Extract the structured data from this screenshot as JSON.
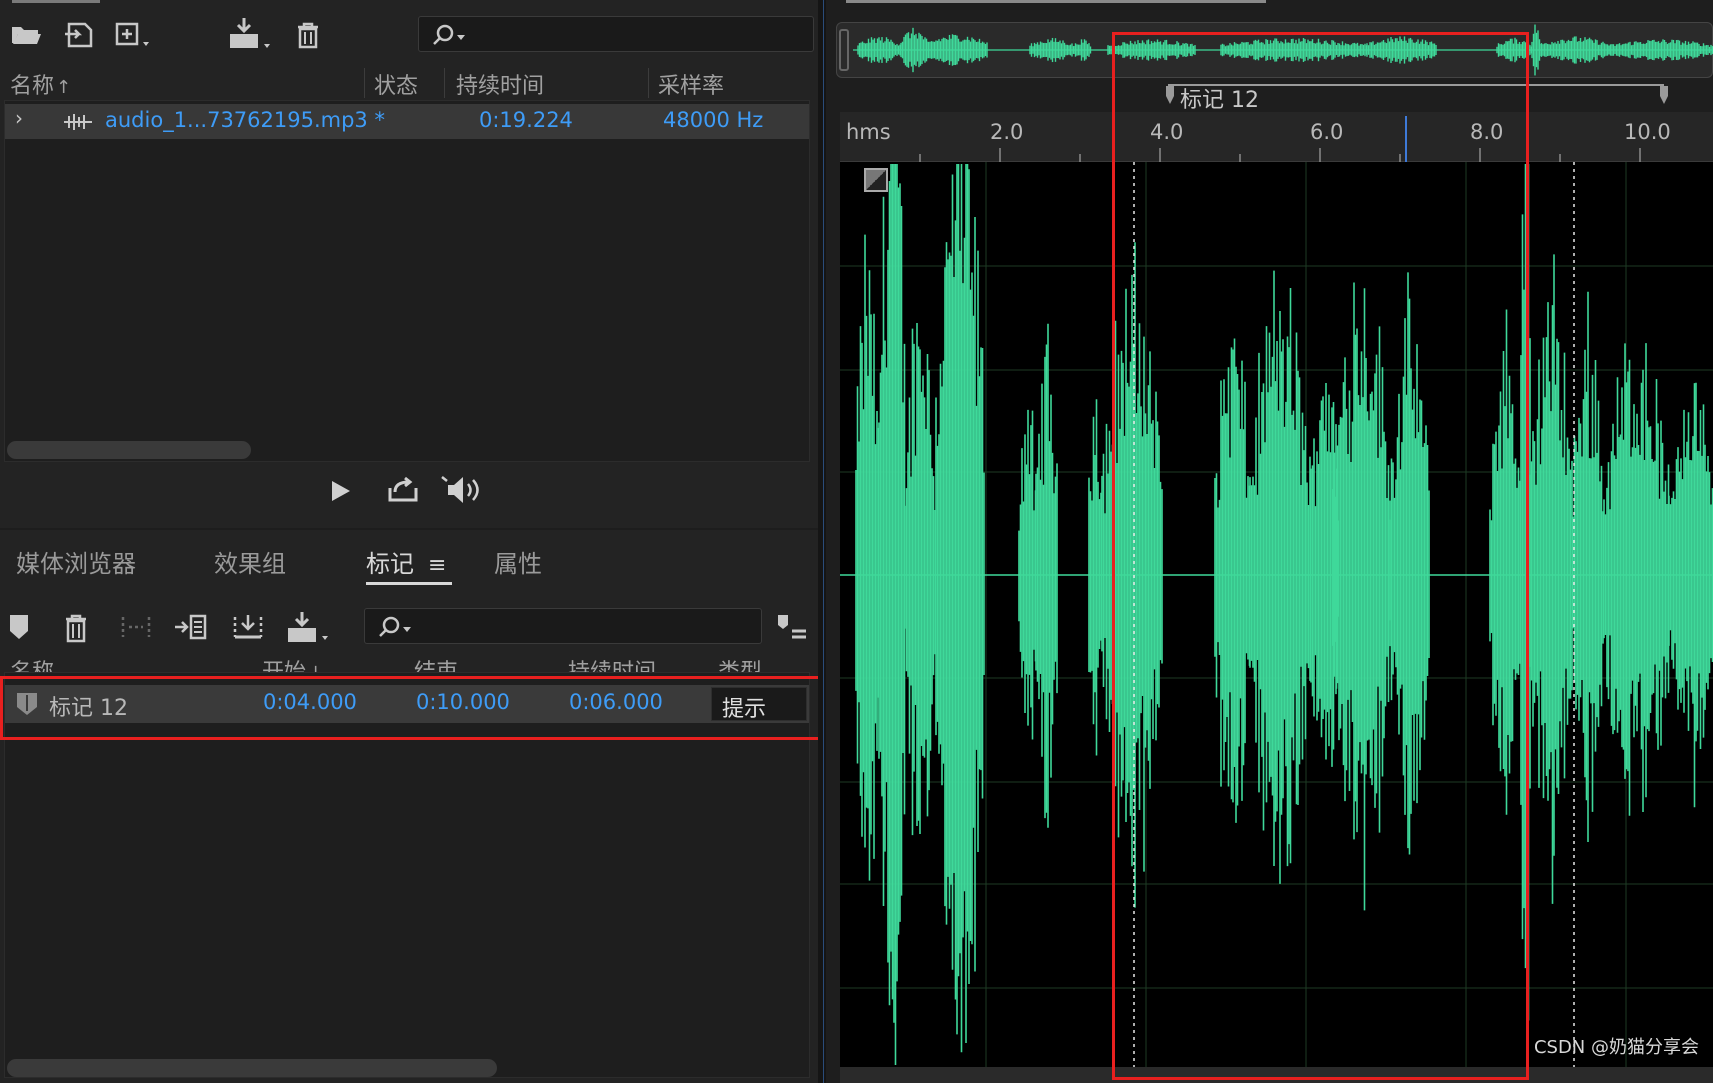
{
  "files_panel": {
    "search_placeholder": "",
    "columns": [
      "名称",
      "状态",
      "持续时间",
      "采样率"
    ],
    "sort_arrow": "↑",
    "file": {
      "name": "audio_1...73762195.mp3 *",
      "status": "",
      "duration": "0:19.224",
      "sample_rate": "48000 Hz"
    }
  },
  "transport": {
    "icons": [
      "play-icon",
      "loop-export-icon",
      "speaker-icon"
    ]
  },
  "tabs": [
    {
      "label": "媒体浏览器",
      "active": false
    },
    {
      "label": "效果组",
      "active": false
    },
    {
      "label": "标记",
      "active": true
    },
    {
      "label": "属性",
      "active": false
    }
  ],
  "marker_panel": {
    "search_placeholder": "",
    "columns": [
      "名称",
      "开始",
      "结束",
      "持续时间",
      "类型"
    ],
    "sort_arrow": "↓",
    "marker": {
      "name": "标记 12",
      "start": "0:04.000",
      "end": "0:10.000",
      "duration": "0:06.000",
      "type": "提示"
    }
  },
  "editor": {
    "marker_label": "标记 12",
    "ruler_unit": "hms",
    "ticks": [
      "2.0",
      "4.0",
      "6.0",
      "8.0",
      "10.0"
    ],
    "watermark": "CSDN @奶猫分享会"
  },
  "colors": {
    "waveform": "#3fd99a",
    "highlight": "#e8201f",
    "accent": "#3e9cf7"
  }
}
